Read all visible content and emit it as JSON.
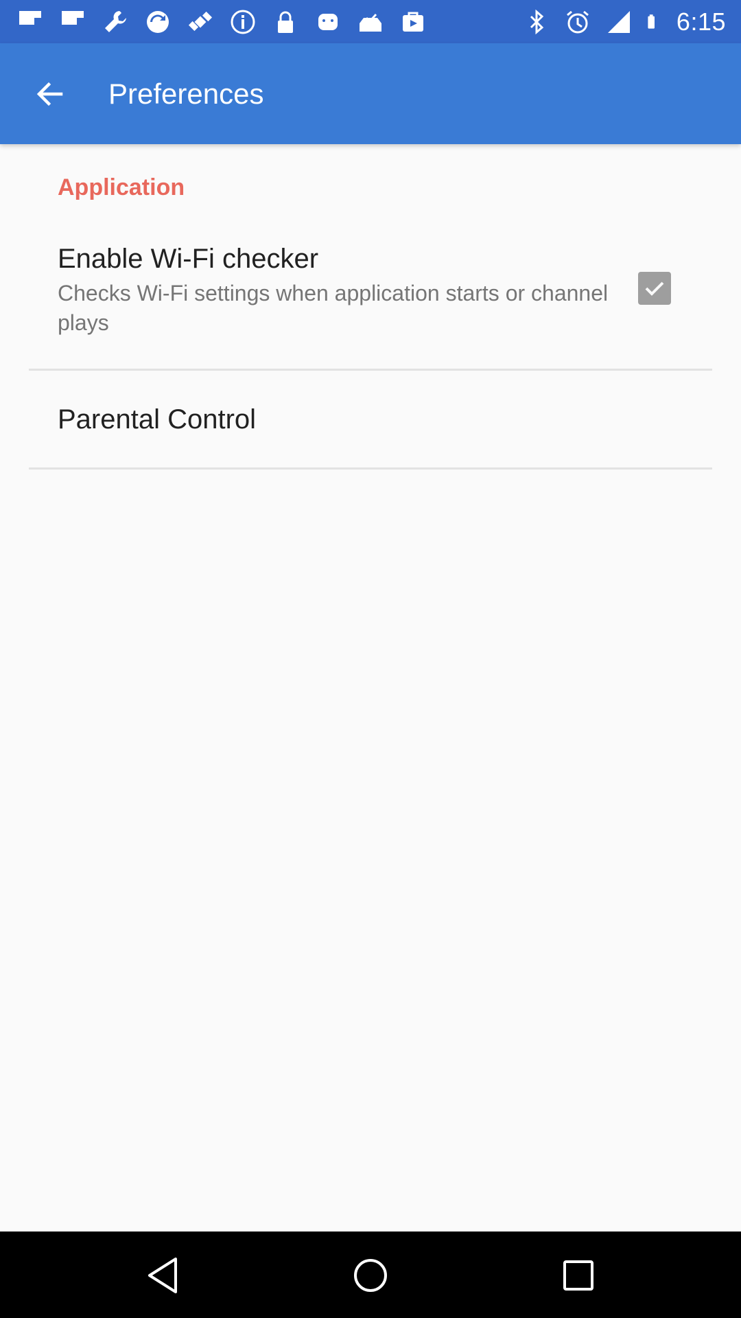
{
  "status_bar": {
    "time": "6:15",
    "left_icons": [
      "flipboard-icon",
      "flipboard-icon",
      "wrench-icon",
      "sync-circle-icon",
      "fake-gps-satellite-icon",
      "info-circle-icon",
      "lock-icon",
      "android-icon",
      "inbox-check-icon",
      "briefcase-icon"
    ],
    "right_icons": [
      "bluetooth-icon",
      "alarm-icon",
      "signal-icon",
      "battery-icon"
    ],
    "background": "#3367c8"
  },
  "app_bar": {
    "title": "Preferences",
    "back_icon": "arrow-back-icon",
    "background": "#3a7bd5"
  },
  "sections": [
    {
      "header": "Application",
      "header_color": "#e8685c",
      "items": [
        {
          "title": "Enable Wi-Fi checker",
          "summary": "Checks Wi-Fi settings when application starts or channel plays",
          "checked": true
        },
        {
          "title": "Parental Control"
        }
      ]
    }
  ],
  "nav_bar": {
    "back_icon": "nav-back-triangle-icon",
    "home_icon": "nav-home-circle-icon",
    "recents_icon": "nav-recents-square-icon"
  }
}
